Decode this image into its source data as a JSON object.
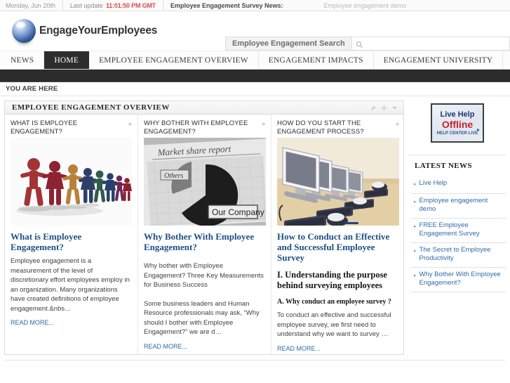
{
  "topbar": {
    "date": "Monday, Jun 20th",
    "last_update_label": "Last update",
    "last_update_time": "11:01:50 PM GMT",
    "news_label": "Employee Engagement Survey News:",
    "news_item": "Employee engagement demo"
  },
  "header": {
    "logo_text": "EngageYourEmployees",
    "search_label": "Employee Engagement Search",
    "search_value": "",
    "search_placeholder": ""
  },
  "nav": {
    "items": [
      {
        "label": "NEWS",
        "active": false
      },
      {
        "label": "HOME",
        "active": true
      },
      {
        "label": "EMPLOYEE ENGAGEMENT OVERVIEW",
        "active": false
      },
      {
        "label": "ENGAGEMENT IMPACTS",
        "active": false
      },
      {
        "label": "ENGAGEMENT UNIVERSITY",
        "active": false
      }
    ]
  },
  "breadcrumb": {
    "label": "YOU ARE HERE"
  },
  "panel": {
    "title": "EMPLOYEE ENGAGEMENT OVERVIEW",
    "tools": [
      "wrench-icon",
      "move-icon",
      "chevron-down-icon"
    ]
  },
  "columns": [
    {
      "head": "WHAT IS EMPLOYEE ENGAGEMENT?",
      "chevron": "»",
      "image_name": "paper-people-chain-image",
      "title": "What is Employee Engagement?",
      "body": "Employee engagement is a measurement of the level of discretionary effort employees employ in an organization.    Many organizations have created definitions of employee engagement.&nbs…",
      "read_more": "READ MORE..."
    },
    {
      "head": "WHY BOTHER WITH EMPLOYEE ENGAGEMENT?",
      "chevron": "»",
      "image_name": "market-share-pie-chart-image",
      "image_caption_title": "Market share report",
      "image_caption_others": "Others",
      "image_caption_company": "Our Company",
      "title": "Why Bother With Employee Engagement?",
      "body": "Why bother with Employee Engagement? Three Key Measurements for Business Success",
      "body2": "Some business leaders and Human Resource professionals may ask, “Why should I bother with Employee Engagement?” we are d…",
      "read_more": "READ MORE..."
    },
    {
      "head": "HOW DO YOU START THE ENGAGEMENT PROCESS?",
      "chevron": "»",
      "image_name": "computer-monitors-row-image",
      "title": "How to Conduct an Effective and Successful Employee Survey",
      "heading2": "I. Understanding the purpose behind surveying employees",
      "heading3": "A.  Why conduct an employee survey ?",
      "body": "To conduct an effective and successful employee survey, we first need to understand why we want to survey …",
      "read_more": "READ MORE..."
    }
  ],
  "sidebar": {
    "live_help": {
      "line1": "Live Help",
      "line2": "Offline",
      "line3": "HELP CENTER LIVE"
    },
    "news_title": "LATEST NEWS",
    "news_items": [
      "Live Help",
      "Employee engagement demo",
      "FREE Employee Engagement Survey",
      "The Secret to Employee Productivity",
      "Why Bother With Employee Engagement?"
    ]
  },
  "footer": {
    "text": ""
  },
  "colors": {
    "link": "#2f6aa8",
    "heading": "#1f4f82",
    "accent_red": "#cc2027",
    "nav_active_bg": "#2c2c2c",
    "time_red": "#d94c52"
  }
}
